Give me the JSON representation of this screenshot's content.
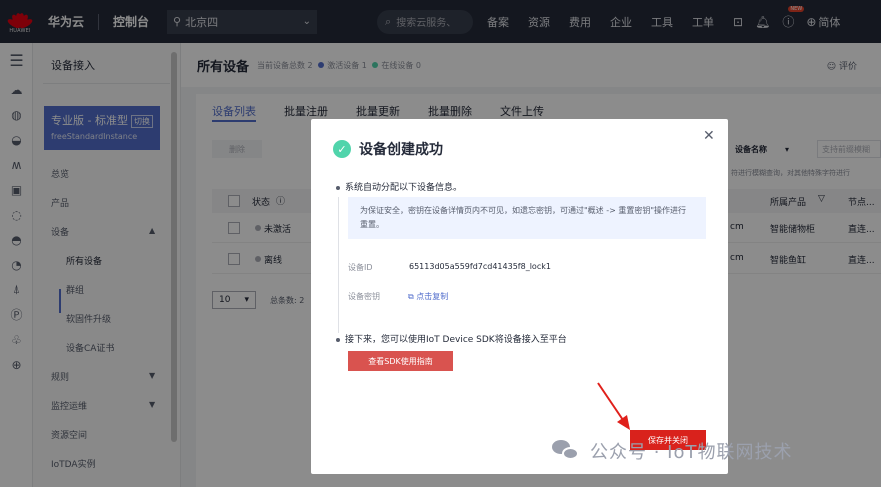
{
  "topbar": {
    "logo_text": "HUAWEI",
    "brand": "华为云",
    "console": "控制台",
    "region": "北京四",
    "search_placeholder": "搜索云服务、",
    "nav": [
      "备案",
      "资源",
      "费用",
      "企业",
      "工具",
      "工单"
    ],
    "new_badge": "NEW",
    "lang": "简体"
  },
  "sidebar": {
    "title": "设备接入",
    "edition_name": "专业版 - 标准型",
    "edition_switch": "切换",
    "edition_id": "freeStandardInstance",
    "items": [
      {
        "label": "总览"
      },
      {
        "label": "产品"
      },
      {
        "label": "设备"
      },
      {
        "label": "所有设备"
      },
      {
        "label": "群组"
      },
      {
        "label": "软固件升级"
      },
      {
        "label": "设备CA证书"
      },
      {
        "label": "规则"
      },
      {
        "label": "监控运维"
      },
      {
        "label": "资源空间"
      },
      {
        "label": "IoTDA实例"
      }
    ]
  },
  "main": {
    "title": "所有设备",
    "stats_total": "当前设备总数 2",
    "stats_activated": "激活设备 1",
    "stats_online": "在线设备 0",
    "rate": "评价",
    "tabs": [
      "设备列表",
      "批量注册",
      "批量更新",
      "批量删除",
      "文件上传"
    ],
    "delete_btn": "删除",
    "col_status": "状态",
    "rows": [
      {
        "status": "未激活",
        "model": "cm",
        "product": "智能储物柜",
        "node": "直连..."
      },
      {
        "status": "离线",
        "model": "cm",
        "product": "智能鱼缸",
        "node": "直连..."
      }
    ],
    "page_size": "10",
    "total": "总条数: 2",
    "filter_select": "设备名称",
    "filter_placeholder": "支持前缀模糊",
    "hint": "符进行模糊查询，对其他特殊字符进行",
    "col_product": "所属产品",
    "col_node": "节点..."
  },
  "dialog": {
    "title": "设备创建成功",
    "line1": "系统自动分配以下设备信息。",
    "notice": "为保证安全，密钥在设备详情页内不可见，如遗忘密钥，可通过\"概述 -> 重置密钥\"操作进行重置。",
    "device_id_label": "设备ID",
    "device_id": "65113d05a559fd7cd41435f8_lock1",
    "secret_label": "设备密钥",
    "copy_label": "点击复制",
    "line2": "接下来，您可以使用IoT Device SDK将设备接入至平台",
    "sdk_btn": "查看SDK使用指南",
    "save_btn": "保存并关闭"
  },
  "watermark": "公众号 · IoT物联网技术",
  "colors": {
    "accent": "#526ecc",
    "success": "#50d4ab",
    "danger": "#d9221c",
    "topbar": "#252b3a"
  }
}
